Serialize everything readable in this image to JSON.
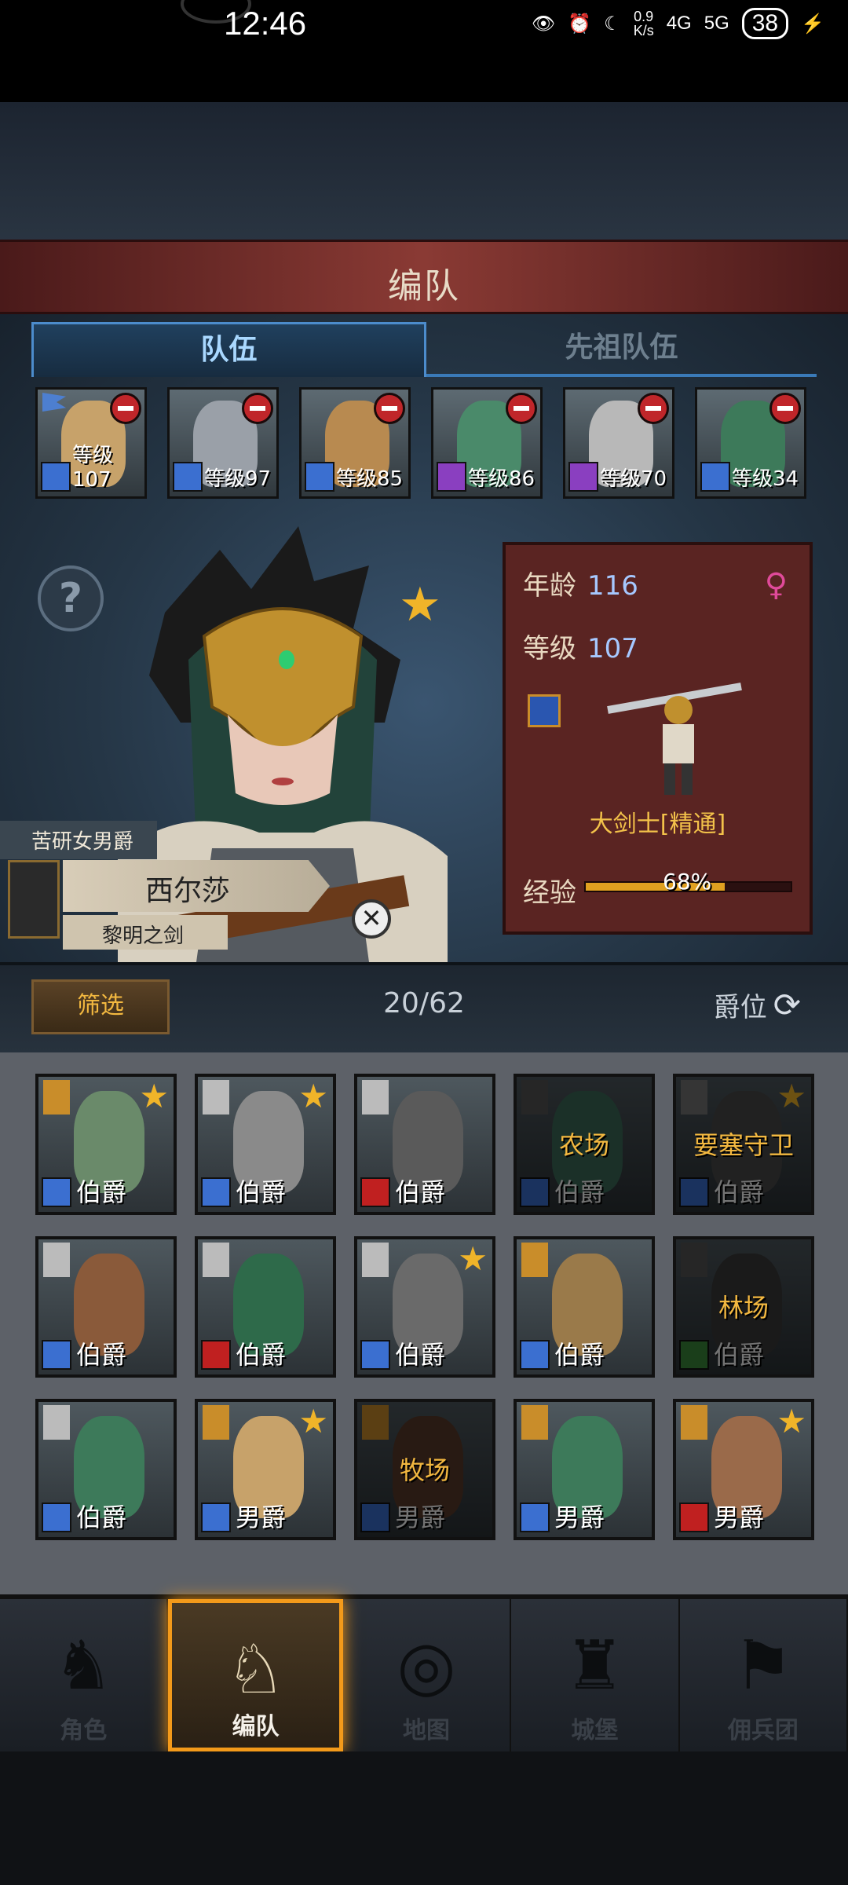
{
  "status_bar": {
    "time": "12:46",
    "net_speed": "0.9",
    "net_unit": "K/s",
    "signal_1": "4G",
    "signal_2": "5G",
    "battery": "38"
  },
  "header": {
    "title": "编队"
  },
  "tabs": [
    {
      "label": "队伍",
      "active": true
    },
    {
      "label": "先祖队伍",
      "active": false
    }
  ],
  "squad": [
    {
      "level": "等级107",
      "class_color": "#3b6fd0",
      "skin": "#c7a26a",
      "leader": true
    },
    {
      "level": "等级97",
      "class_color": "#3b6fd0",
      "skin": "#9aa0a8",
      "leader": false
    },
    {
      "level": "等级85",
      "class_color": "#3b6fd0",
      "skin": "#b88a50",
      "leader": false
    },
    {
      "level": "等级86",
      "class_color": "#8a3fc0",
      "skin": "#4a8a6a",
      "leader": false
    },
    {
      "level": "等级70",
      "class_color": "#8a3fc0",
      "skin": "#b8b8b8",
      "leader": false
    },
    {
      "level": "等级34",
      "class_color": "#3b6fd0",
      "skin": "#3d7a5a",
      "leader": false
    }
  ],
  "hero": {
    "help": "?",
    "star": "★",
    "tag": "苦研女男爵",
    "name": "西尔莎",
    "title": "黎明之剑",
    "close": "✕",
    "age_label": "年龄",
    "age": "116",
    "level_label": "等级",
    "level": "107",
    "gender": "♀",
    "unit_class": "大剑士[精通]",
    "exp_label": "经验",
    "exp_pct": "68%",
    "exp_value": 0.68
  },
  "filter": {
    "button": "筛选",
    "count": "20/62",
    "sort_label": "爵位",
    "sort_icon": "⟳"
  },
  "roster": [
    {
      "rank": "伯爵",
      "assign": "",
      "star": true,
      "dim": false,
      "class_color": "#3b6fd0",
      "skin": "#6a8a6a",
      "corner": "#c98d2a"
    },
    {
      "rank": "伯爵",
      "assign": "",
      "star": true,
      "dim": false,
      "class_color": "#3b6fd0",
      "skin": "#8a8a8a",
      "corner": "#bbbbbb"
    },
    {
      "rank": "伯爵",
      "assign": "",
      "star": false,
      "dim": false,
      "class_color": "#c02020",
      "skin": "#5a5a5a",
      "corner": "#bbbbbb"
    },
    {
      "rank": "伯爵",
      "assign": "农场",
      "star": false,
      "dim": true,
      "class_color": "#3b6fd0",
      "skin": "#3d6a5a",
      "corner": "#555555"
    },
    {
      "rank": "伯爵",
      "assign": "要塞守卫",
      "star": true,
      "dim": true,
      "class_color": "#3b6fd0",
      "skin": "#4a4a4a",
      "corner": "#777777"
    },
    {
      "rank": "伯爵",
      "assign": "",
      "star": false,
      "dim": false,
      "class_color": "#3b6fd0",
      "skin": "#8a5a3a",
      "corner": "#bbbbbb"
    },
    {
      "rank": "伯爵",
      "assign": "",
      "star": false,
      "dim": false,
      "class_color": "#c02020",
      "skin": "#2e6a4a",
      "corner": "#bbbbbb"
    },
    {
      "rank": "伯爵",
      "assign": "",
      "star": true,
      "dim": false,
      "class_color": "#3b6fd0",
      "skin": "#6a6a6a",
      "corner": "#bbbbbb"
    },
    {
      "rank": "伯爵",
      "assign": "",
      "star": false,
      "dim": false,
      "class_color": "#3b6fd0",
      "skin": "#9a7a4a",
      "corner": "#c98d2a"
    },
    {
      "rank": "伯爵",
      "assign": "林场",
      "star": false,
      "dim": true,
      "class_color": "#3a8a3a",
      "skin": "#3a3a3a",
      "corner": "#555555"
    },
    {
      "rank": "伯爵",
      "assign": "",
      "star": false,
      "dim": false,
      "class_color": "#3b6fd0",
      "skin": "#3d7a5a",
      "corner": "#bbbbbb"
    },
    {
      "rank": "男爵",
      "assign": "",
      "star": true,
      "dim": false,
      "class_color": "#3b6fd0",
      "skin": "#c7a26a",
      "corner": "#c98d2a"
    },
    {
      "rank": "男爵",
      "assign": "牧场",
      "star": false,
      "dim": true,
      "class_color": "#3b6fd0",
      "skin": "#5a3a2a",
      "corner": "#c98d2a"
    },
    {
      "rank": "男爵",
      "assign": "",
      "star": false,
      "dim": false,
      "class_color": "#3b6fd0",
      "skin": "#3d7a5a",
      "corner": "#c98d2a"
    },
    {
      "rank": "男爵",
      "assign": "",
      "star": true,
      "dim": false,
      "class_color": "#c02020",
      "skin": "#9a6a4a",
      "corner": "#c98d2a"
    }
  ],
  "nav": [
    {
      "label": "角色",
      "icon": "♞",
      "active": false
    },
    {
      "label": "编队",
      "icon": "♘",
      "active": true
    },
    {
      "label": "地图",
      "icon": "◎",
      "active": false
    },
    {
      "label": "城堡",
      "icon": "♜",
      "active": false
    },
    {
      "label": "佣兵团",
      "icon": "⚑",
      "active": false
    }
  ]
}
